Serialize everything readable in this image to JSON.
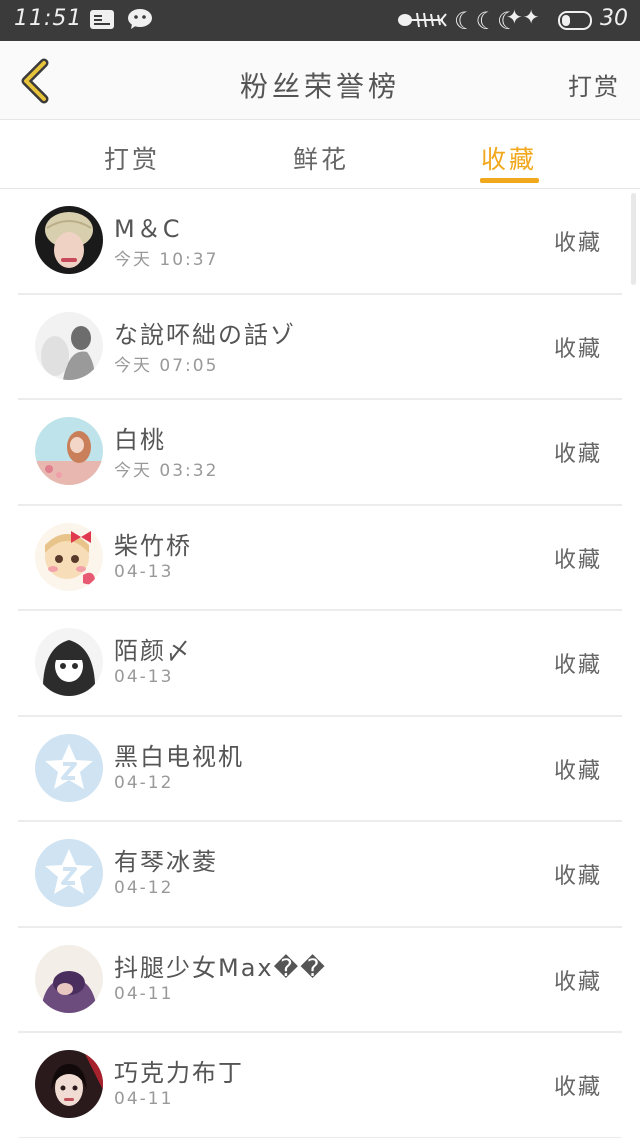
{
  "status_bar": {
    "time": "11:51",
    "battery_level": "30",
    "network": "4G"
  },
  "header": {
    "title": "粉丝荣誉榜",
    "action_label": "打赏"
  },
  "tabs": [
    {
      "label": "打赏",
      "active": false
    },
    {
      "label": "鲜花",
      "active": false
    },
    {
      "label": "收藏",
      "active": true
    }
  ],
  "accent_color": "#f1a81c",
  "list": [
    {
      "name": "M＆C",
      "time": "今天 10:37",
      "action": "收藏",
      "avatar": "photo-avatar-knit-hat"
    },
    {
      "name": "な說吥絀の話ゾ",
      "time": "今天 07:05",
      "action": "收藏",
      "avatar": "photo-avatar-grayscale"
    },
    {
      "name": "白桃",
      "time": "今天 03:32",
      "action": "收藏",
      "avatar": "photo-avatar-pastel"
    },
    {
      "name": "柴竹桥",
      "time": "04-13",
      "action": "收藏",
      "avatar": "cartoon-avatar-bow"
    },
    {
      "name": "陌颜〆",
      "time": "04-13",
      "action": "收藏",
      "avatar": "sketch-avatar-girl"
    },
    {
      "name": "黑白电视机",
      "time": "04-12",
      "action": "收藏",
      "avatar": "default-star-avatar"
    },
    {
      "name": "有琴冰菱",
      "time": "04-12",
      "action": "收藏",
      "avatar": "default-star-avatar"
    },
    {
      "name": "抖腿少女Max��",
      "time": "04-11",
      "action": "收藏",
      "avatar": "photo-avatar-purple"
    },
    {
      "name": "巧克力布丁",
      "time": "04-11",
      "action": "收藏",
      "avatar": "photo-avatar-dark-hair"
    }
  ]
}
